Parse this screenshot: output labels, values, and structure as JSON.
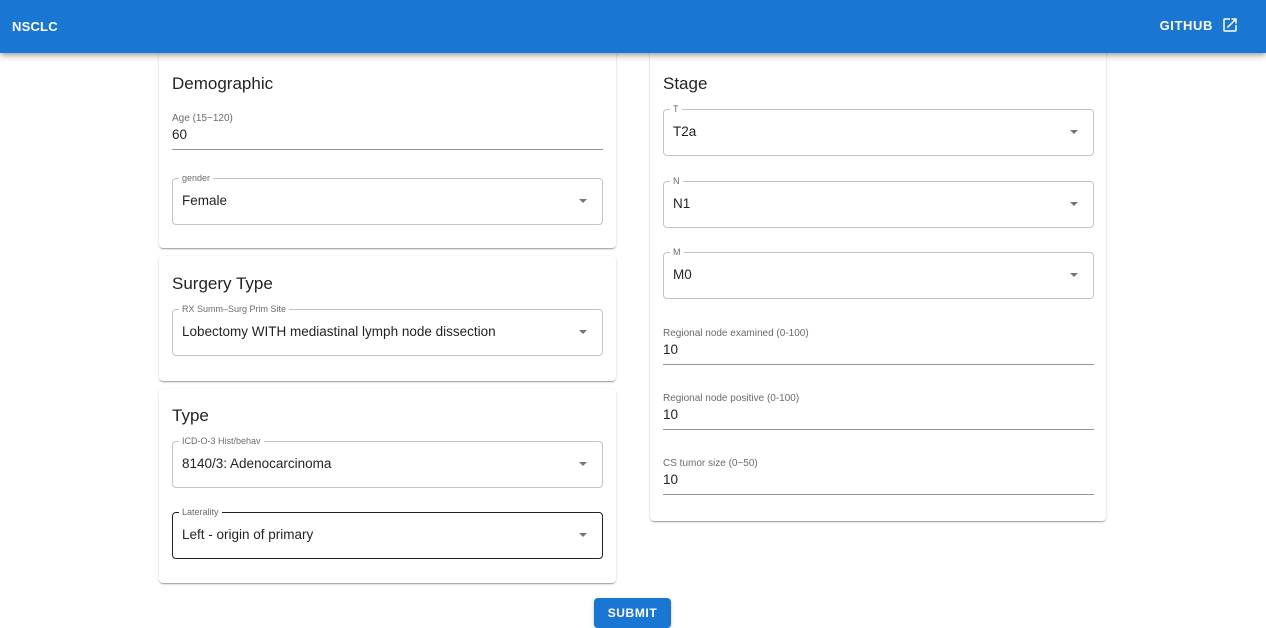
{
  "appbar": {
    "title": "NSCLC",
    "github_label": "GITHUB"
  },
  "demographic": {
    "title": "Demographic",
    "age": {
      "label": "Age (15~120)",
      "value": "60"
    },
    "gender": {
      "label": "gender",
      "value": "Female"
    }
  },
  "surgery": {
    "title": "Surgery Type",
    "site": {
      "label": "RX Summ–Surg Prim Site",
      "value": "Lobectomy WITH mediastinal lymph node dissection"
    }
  },
  "type": {
    "title": "Type",
    "histology": {
      "label": "ICD-O-3 Hist/behav",
      "value": "8140/3: Adenocarcinoma"
    },
    "laterality": {
      "label": "Laterality",
      "value": "Left - origin of primary"
    }
  },
  "stage": {
    "title": "Stage",
    "t": {
      "label": "T",
      "value": "T2a"
    },
    "n": {
      "label": "N",
      "value": "N1"
    },
    "m": {
      "label": "M",
      "value": "M0"
    },
    "nodes_examined": {
      "label": "Regional node examined (0-100)",
      "value": "10"
    },
    "nodes_positive": {
      "label": "Regional node positive (0-100)",
      "value": "10"
    },
    "tumor_size": {
      "label": "CS tumor size (0~50)",
      "value": "10"
    }
  },
  "submit_label": "SUBMIT",
  "icons": {
    "external_link": "open-in-new-icon",
    "dropdown": "arrow-drop-down-icon"
  },
  "colors": {
    "primary": "#1976d2"
  }
}
